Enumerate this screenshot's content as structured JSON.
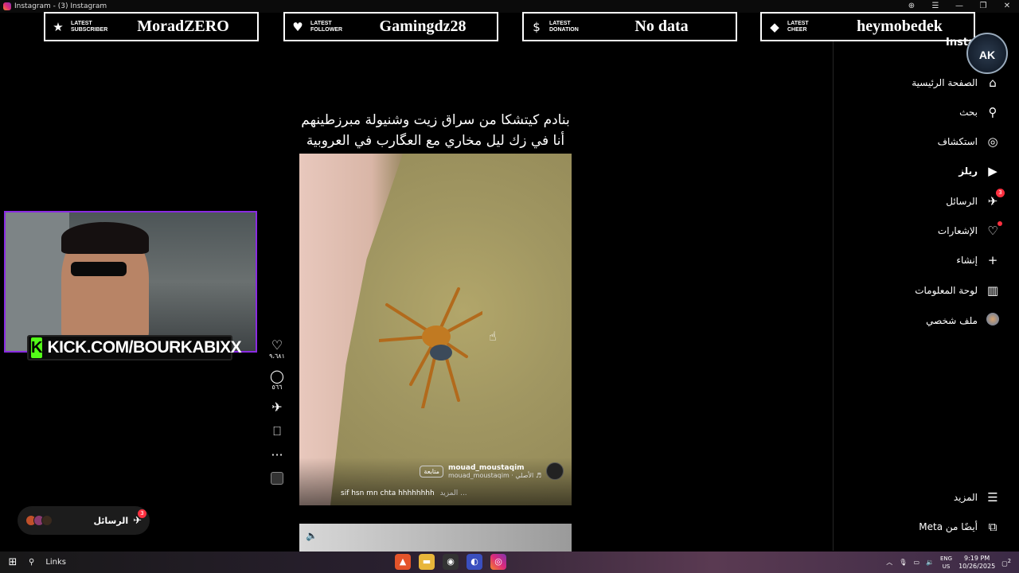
{
  "window": {
    "title": "Instagram - (3) Instagram",
    "controls": [
      "⊕",
      "☰",
      "—",
      "❐",
      "✕"
    ]
  },
  "alerts": [
    {
      "label1": "LATEST",
      "label2": "SUBSCRIBER",
      "value": "MoradZERO",
      "icon": "star-icon",
      "glyph": "★"
    },
    {
      "label1": "LATEST",
      "label2": "FOLLOWER",
      "value": "Gamingdz28",
      "icon": "heart-icon",
      "glyph": "♥"
    },
    {
      "label1": "LATEST",
      "label2": "DONATION",
      "value": "No data",
      "icon": "dollar-icon",
      "glyph": "$"
    },
    {
      "label1": "LATEST",
      "label2": "CHEER",
      "value": "heymobedek",
      "icon": "diamond-icon",
      "glyph": "◆"
    }
  ],
  "stream": {
    "kick_text": "KICK.COM/BOURKABIXX",
    "kick_logo": "K",
    "brand_logo": "AK"
  },
  "post": {
    "caption_line1": "بنادم كيتشكا من سراق زيت وشنيولة مبرزطينهم",
    "caption_line2": "أنا في زك ليل مخاري مع العگارب في العروبية",
    "username": "mouad_moustaqim",
    "audio": "mouad_moustaqim · الأصلي ♬",
    "follow": "متابعة",
    "text": "sif hsn mn chta hhhhhhhh",
    "more": "المزيد ..."
  },
  "actions": {
    "likes": "٩،٦٨١",
    "comments": "٥٦٦"
  },
  "sidebar": {
    "brand_text": "Insta",
    "items": [
      {
        "label": "الصفحة الرئيسية",
        "icon": "home-icon",
        "glyph": "⌂"
      },
      {
        "label": "بحث",
        "icon": "search-icon",
        "glyph": "⚲"
      },
      {
        "label": "استكشاف",
        "icon": "compass-icon",
        "glyph": "◎"
      },
      {
        "label": "ريلز",
        "icon": "reels-icon",
        "glyph": "▶"
      },
      {
        "label": "الرسائل",
        "icon": "messenger-icon",
        "glyph": "✈",
        "badge": "3"
      },
      {
        "label": "الإشعارات",
        "icon": "heart-icon",
        "glyph": "♡"
      },
      {
        "label": "إنشاء",
        "icon": "plus-icon",
        "glyph": "+"
      },
      {
        "label": "لوحة المعلومات",
        "icon": "dashboard-icon",
        "glyph": "▥"
      },
      {
        "label": "ملف شخصي",
        "icon": "profile-icon",
        "glyph": ""
      }
    ],
    "more": "المزيد",
    "meta": "أيضًا من Meta"
  },
  "messages_float": {
    "label": "الرسائل",
    "badge": "3"
  },
  "taskbar": {
    "search_label": "Links",
    "lang1": "ENG",
    "lang2": "US",
    "time": "9:19 PM",
    "date": "10/26/2025",
    "notif": "2"
  }
}
